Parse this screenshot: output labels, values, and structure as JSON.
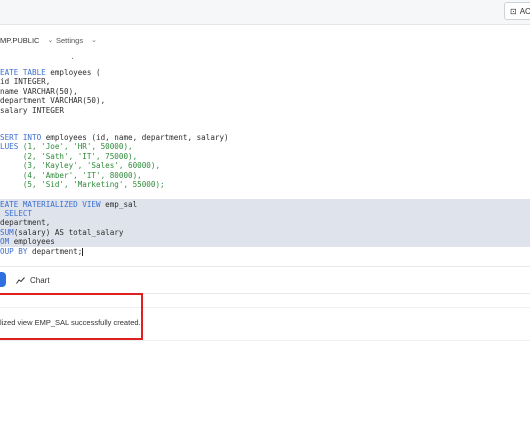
{
  "topbar": {
    "account_label": "AC"
  },
  "toolbar": {
    "context_label": "MP.PUBLIC",
    "settings_label": "Settings"
  },
  "editor": {
    "dot_marker": ".",
    "lines": [
      {
        "kw": "EATE TABLE",
        "rest": " employees ("
      },
      {
        "plain": "id INTEGER,"
      },
      {
        "plain": "name VARCHAR(50),"
      },
      {
        "plain": "department VARCHAR(50),"
      },
      {
        "plain": "salary INTEGER"
      },
      {
        "kw": "SERT INTO",
        "rest": " employees (id, name, department, salary)"
      },
      {
        "kw": "LUES",
        "rest": " (1, 'Joe', 'HR', 50000),"
      },
      {
        "plain": "     (2, 'Sath', 'IT', 75000),"
      },
      {
        "plain": "     (3, 'Kayley', 'Sales', 60000),"
      },
      {
        "plain": "     (4, 'Amber', 'IT', 80000),"
      },
      {
        "plain": "     (5, 'Sid', 'Marketing', 55000);"
      },
      {
        "kw": "EATE MATERIALIZED VIEW",
        "rest": " emp_sal"
      },
      {
        "kw": " SELECT",
        "rest": ""
      },
      {
        "plain": "department,"
      },
      {
        "kw": "SUM",
        "rest": "(salary) AS total_salary"
      },
      {
        "kw": "OM",
        "rest": " employees"
      },
      {
        "kw": "OUP BY",
        "rest": " department;"
      }
    ]
  },
  "results": {
    "chart_tab_label": "Chart",
    "message": "lized view EMP_SAL successfully created."
  }
}
